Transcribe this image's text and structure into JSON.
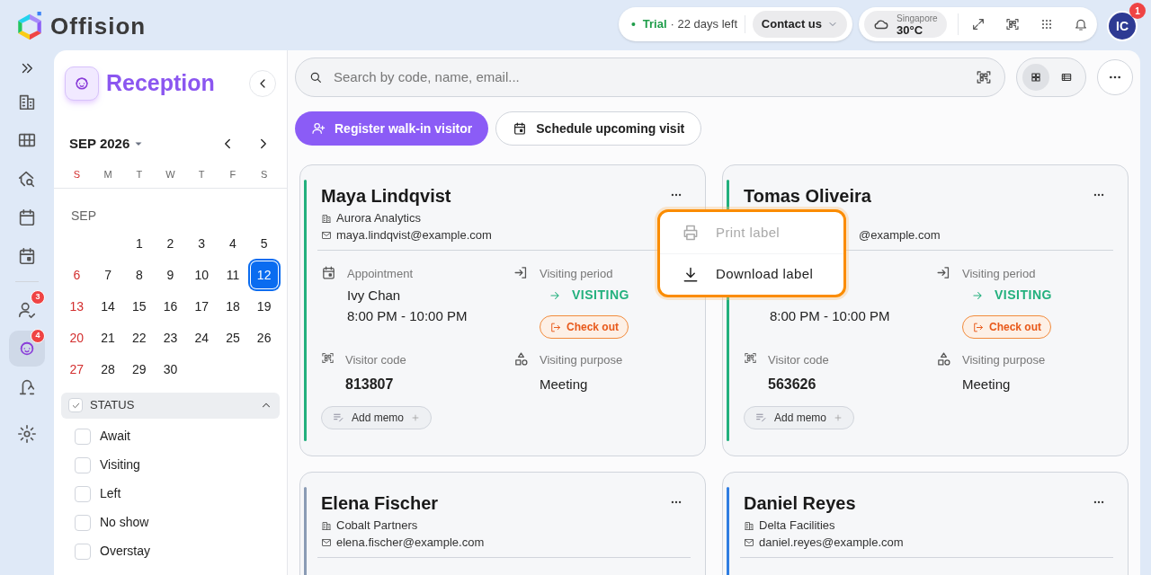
{
  "brand": {
    "name": "Offision"
  },
  "topbar": {
    "trial_label": "Trial",
    "trial_rest": "· 22 days left",
    "contact": "Contact us",
    "weather_city": "Singapore",
    "weather_temp": "30°C",
    "avatar": "IC",
    "avatar_badge": "1"
  },
  "rail": [
    {
      "selected": false
    },
    {
      "selected": false
    },
    {
      "selected": false
    },
    {
      "selected": false
    },
    {
      "selected": false
    },
    {
      "selected": false,
      "badge": "3"
    },
    {
      "selected": true,
      "badge": "4"
    },
    {
      "selected": false
    },
    {
      "selected": false
    }
  ],
  "sidebar": {
    "title": "Reception",
    "month": "SEP 2026",
    "weekdays": [
      {
        "label": "S",
        "holiday": true
      },
      {
        "label": "M",
        "holiday": false
      },
      {
        "label": "T",
        "holiday": false
      },
      {
        "label": "W",
        "holiday": false
      },
      {
        "label": "T",
        "holiday": false
      },
      {
        "label": "F",
        "holiday": false
      },
      {
        "label": "S",
        "holiday": false
      }
    ],
    "section": "SEP",
    "weeks": [
      [
        {
          "label": "1",
          "holiday": false,
          "selected": false
        },
        {
          "label": "2",
          "holiday": false,
          "selected": false
        },
        {
          "label": "3",
          "holiday": false,
          "selected": false
        },
        {
          "label": "4",
          "holiday": false,
          "selected": false
        },
        {
          "label": "5",
          "holiday": false,
          "selected": false
        }
      ],
      [
        {
          "label": "6",
          "holiday": true,
          "selected": false
        },
        {
          "label": "7",
          "holiday": false,
          "selected": false
        },
        {
          "label": "8",
          "holiday": false,
          "selected": false
        },
        {
          "label": "9",
          "holiday": false,
          "selected": false
        },
        {
          "label": "10",
          "holiday": false,
          "selected": false
        },
        {
          "label": "11",
          "holiday": false,
          "selected": false
        },
        {
          "label": "12",
          "holiday": false,
          "selected": true
        }
      ],
      [
        {
          "label": "13",
          "holiday": true,
          "selected": false
        },
        {
          "label": "14",
          "holiday": false,
          "selected": false
        },
        {
          "label": "15",
          "holiday": false,
          "selected": false
        },
        {
          "label": "16",
          "holiday": false,
          "selected": false
        },
        {
          "label": "17",
          "holiday": false,
          "selected": false
        },
        {
          "label": "18",
          "holiday": false,
          "selected": false
        },
        {
          "label": "19",
          "holiday": false,
          "selected": false
        }
      ],
      [
        {
          "label": "20",
          "holiday": true,
          "selected": false
        },
        {
          "label": "21",
          "holiday": false,
          "selected": false
        },
        {
          "label": "22",
          "holiday": false,
          "selected": false
        },
        {
          "label": "23",
          "holiday": false,
          "selected": false
        },
        {
          "label": "24",
          "holiday": false,
          "selected": false
        },
        {
          "label": "25",
          "holiday": false,
          "selected": false
        },
        {
          "label": "26",
          "holiday": false,
          "selected": false
        }
      ],
      [
        {
          "label": "27",
          "holiday": true,
          "selected": false
        },
        {
          "label": "28",
          "holiday": false,
          "selected": false
        },
        {
          "label": "29",
          "holiday": false,
          "selected": false
        },
        {
          "label": "30",
          "holiday": false,
          "selected": false
        }
      ]
    ],
    "filter": {
      "title": "STATUS",
      "checked": true,
      "expanded": true,
      "options": [
        {
          "label": "Await",
          "checked": false
        },
        {
          "label": "Visiting",
          "checked": false
        },
        {
          "label": "Left",
          "checked": false
        },
        {
          "label": "No show",
          "checked": false
        },
        {
          "label": "Overstay",
          "checked": false
        }
      ]
    }
  },
  "search": {
    "placeholder": "Search by code, name, email..."
  },
  "view_toggle": [
    {
      "selected": true
    },
    {
      "selected": false
    }
  ],
  "actions": [
    {
      "label": "Register walk-in visitor",
      "kind": "primary"
    },
    {
      "label": "Schedule upcoming visit",
      "kind": "secondary"
    }
  ],
  "cards": [
    {
      "name": "Maya Lindqvist",
      "company": "Aurora Analytics",
      "email": "maya.lindqvist@example.com",
      "color": "#22b07d",
      "appointment_label": "Appointment",
      "host": "Ivy Chan",
      "time": "8:00 PM - 10:00 PM",
      "period_label": "Visiting period",
      "status": "VISITING",
      "checkout": "Check out",
      "code_label": "Visitor code",
      "code": "813807",
      "purpose_label": "Visiting purpose",
      "purpose": "Meeting",
      "memo": "Add memo"
    },
    {
      "name": "Tomas Oliveira",
      "email": "@example.com",
      "partly_covered": true,
      "color": "#22b07d",
      "time": "8:00 PM - 10:00 PM",
      "period_label": "Visiting period",
      "status": "VISITING",
      "checkout": "Check out",
      "code_label": "Visitor code",
      "code": "563626",
      "purpose_label": "Visiting purpose",
      "purpose": "Meeting",
      "memo": "Add memo"
    },
    {
      "name": "Elena Fischer",
      "company": "Cobalt Partners",
      "email": "elena.fischer@example.com",
      "color": "#8a9bb5"
    },
    {
      "name": "Daniel Reyes",
      "company": "Delta Facilities",
      "email": "daniel.reyes@example.com",
      "color": "#2f7de1"
    }
  ],
  "menu": [
    {
      "label": "Print label",
      "disabled": true
    },
    {
      "label": "Download label",
      "disabled": false
    }
  ]
}
